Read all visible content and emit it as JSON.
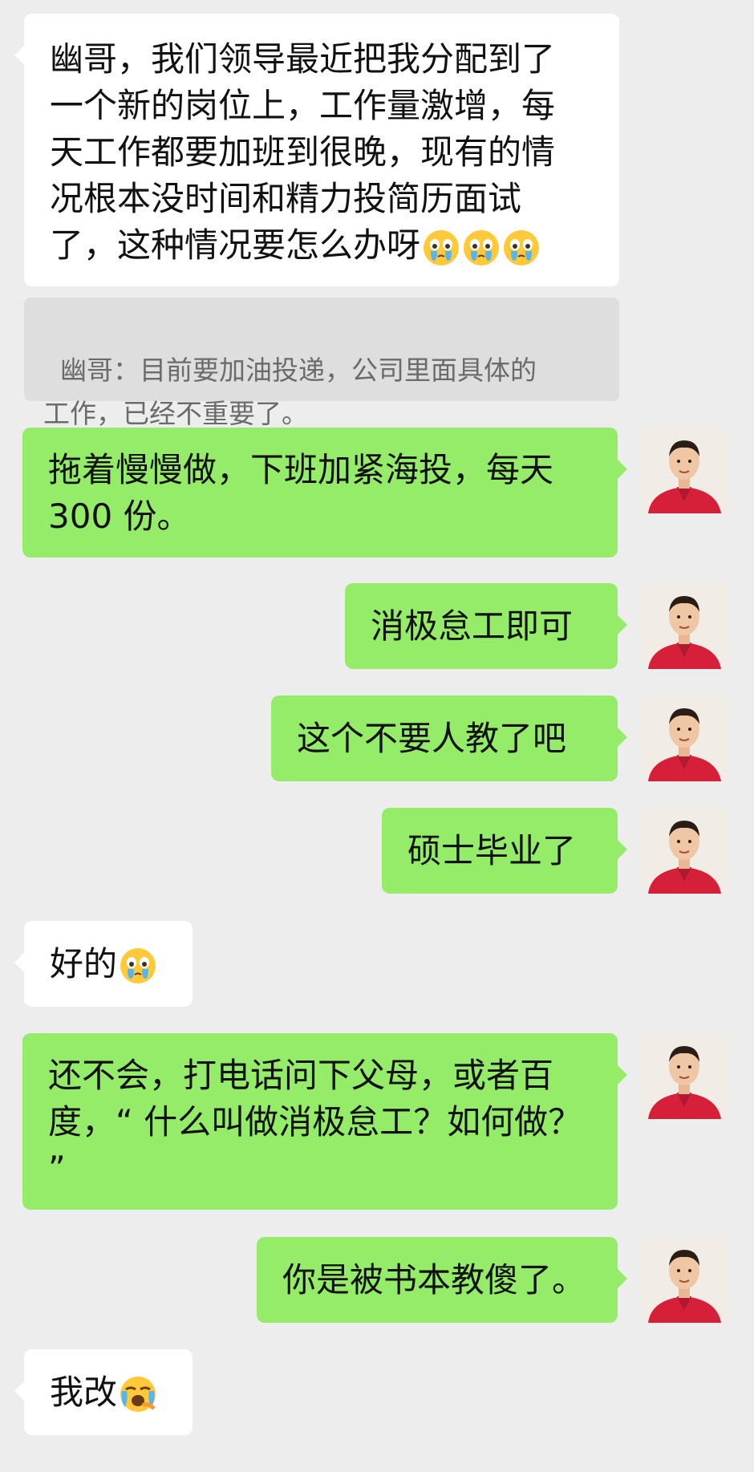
{
  "messages": [
    {
      "side": "left",
      "text": "幽哥，我们领导最近把我分配到了\n一个新的岗位上，工作量激增，每\n天工作都要加班到很晚，现有的情\n况根本没时间和精力投简历面试\n了，这种情况要怎么办呀",
      "emoji": [
        "crying-face-icon",
        "crying-face-icon",
        "crying-face-icon"
      ]
    },
    {
      "side": "quote",
      "text": "幽哥：目前要加油投递，公司里面具体的\n工作，已经不重要了。"
    },
    {
      "side": "right",
      "text": "拖着慢慢做，下班加紧海投，每天\n300 份。"
    },
    {
      "side": "right",
      "text": "消极怠工即可"
    },
    {
      "side": "right",
      "text": "这个不要人教了吧"
    },
    {
      "side": "right",
      "text": "硕士毕业了"
    },
    {
      "side": "left",
      "text": "好的",
      "emoji": [
        "crying-face-icon"
      ]
    },
    {
      "side": "right",
      "text": "还不会，打电话问下父母，或者百\n度，“ 什么叫做消极怠工？如何做？\n”"
    },
    {
      "side": "right",
      "text": "你是被书本教傻了。"
    },
    {
      "side": "left",
      "text": "我改",
      "emoji": [
        "loudly-crying-face-icon"
      ]
    }
  ],
  "colors": {
    "background": "#ededed",
    "left_bubble": "#ffffff",
    "right_bubble": "#95ec69",
    "quote_bg": "#dedede",
    "avatar_shirt": "#d6203a"
  }
}
